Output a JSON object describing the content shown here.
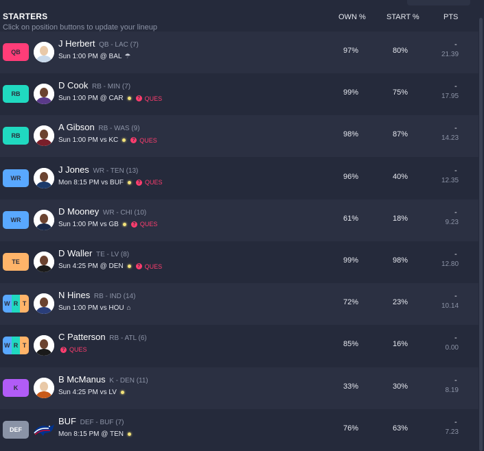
{
  "header": {
    "title": "STARTERS",
    "subtitle": "Click on position buttons to update your lineup",
    "col_own": "OWN %",
    "col_start": "START %",
    "col_pts": "PTS"
  },
  "colors": {
    "QB": "#ff3d78",
    "RB": "#20d9c0",
    "WR": "#59a8ff",
    "TE": "#ffb469",
    "K": "#b15cf7",
    "DEF": "#8a93a6",
    "ques": "#ff3d6e"
  },
  "rows": [
    {
      "pos": "QB",
      "name": "J Herbert",
      "meta": "QB - LAC (7)",
      "game": "Sun 1:00 PM @ BAL",
      "weather": "rain-icon",
      "status": "",
      "own": "97%",
      "start": "80%",
      "pts_dash": "-",
      "pts": "21.39"
    },
    {
      "pos": "RB",
      "name": "D Cook",
      "meta": "RB - MIN (7)",
      "game": "Sun 1:00 PM @ CAR",
      "weather": "sun-icon",
      "status": "QUES",
      "own": "99%",
      "start": "75%",
      "pts_dash": "-",
      "pts": "17.95"
    },
    {
      "pos": "RB",
      "name": "A Gibson",
      "meta": "RB - WAS (9)",
      "game": "Sun 1:00 PM vs KC",
      "weather": "sun-icon",
      "status": "QUES",
      "own": "98%",
      "start": "87%",
      "pts_dash": "-",
      "pts": "14.23"
    },
    {
      "pos": "WR",
      "name": "J Jones",
      "meta": "WR - TEN (13)",
      "game": "Mon 8:15 PM vs BUF",
      "weather": "sun-icon",
      "status": "QUES",
      "own": "96%",
      "start": "40%",
      "pts_dash": "-",
      "pts": "12.35"
    },
    {
      "pos": "WR",
      "name": "D Mooney",
      "meta": "WR - CHI (10)",
      "game": "Sun 1:00 PM vs GB",
      "weather": "sun-icon",
      "status": "QUES",
      "own": "61%",
      "start": "18%",
      "pts_dash": "-",
      "pts": "9.23"
    },
    {
      "pos": "TE",
      "name": "D Waller",
      "meta": "TE - LV (8)",
      "game": "Sun 4:25 PM @ DEN",
      "weather": "sun-icon",
      "status": "QUES",
      "own": "99%",
      "start": "98%",
      "pts_dash": "-",
      "pts": "12.80"
    },
    {
      "pos": "W R T",
      "flex": [
        "W",
        "R",
        "T"
      ],
      "name": "N Hines",
      "meta": "RB - IND (14)",
      "game": "Sun 1:00 PM vs HOU",
      "weather": "dome-icon",
      "status": "",
      "own": "72%",
      "start": "23%",
      "pts_dash": "-",
      "pts": "10.14"
    },
    {
      "pos": "W R T",
      "flex": [
        "W",
        "R",
        "T"
      ],
      "name": "C Patterson",
      "meta": "RB - ATL (6)",
      "game": "",
      "weather": "",
      "status": "QUES",
      "own": "85%",
      "start": "16%",
      "pts_dash": "-",
      "pts": "0.00"
    },
    {
      "pos": "K",
      "name": "B McManus",
      "meta": "K - DEN (11)",
      "game": "Sun 4:25 PM vs LV",
      "weather": "sun-icon",
      "status": "",
      "own": "33%",
      "start": "30%",
      "pts_dash": "-",
      "pts": "8.19"
    },
    {
      "pos": "DEF",
      "name": "BUF",
      "meta": "DEF - BUF (7)",
      "game": "Mon 8:15 PM @ TEN",
      "weather": "sun-icon",
      "status": "",
      "own": "76%",
      "start": "63%",
      "pts_dash": "-",
      "pts": "7.23"
    }
  ]
}
